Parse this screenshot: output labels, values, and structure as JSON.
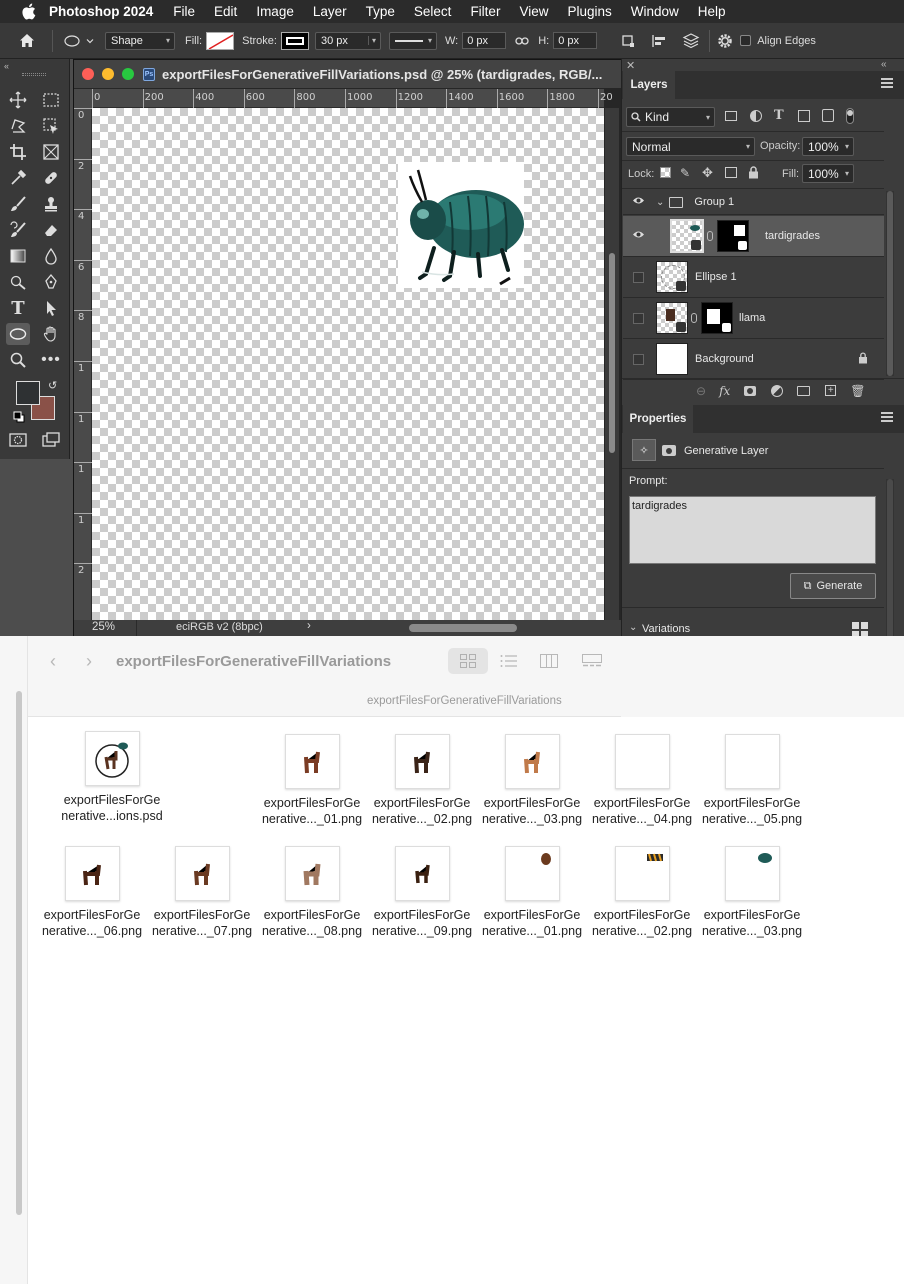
{
  "menubar": {
    "app": "Photoshop 2024",
    "items": [
      "File",
      "Edit",
      "Image",
      "Layer",
      "Type",
      "Select",
      "Filter",
      "View",
      "Plugins",
      "Window",
      "Help"
    ]
  },
  "options": {
    "mode": "Shape",
    "fill_label": "Fill:",
    "stroke_label": "Stroke:",
    "stroke_width": "30 px",
    "w_label": "W:",
    "w_value": "0 px",
    "h_label": "H:",
    "h_value": "0 px",
    "align_edges": "Align Edges"
  },
  "document": {
    "title": "exportFilesForGenerativeFillVariations.psd @ 25% (tardigrades, RGB/...",
    "ruler_h": [
      "0",
      "200",
      "400",
      "600",
      "800",
      "1000",
      "1200",
      "1400",
      "1600",
      "1800",
      "20"
    ],
    "ruler_v": [
      "0",
      "2",
      "4",
      "6",
      "8",
      "1",
      "1",
      "1",
      "1",
      "2"
    ],
    "zoom": "25%",
    "profile": "eciRGB v2 (8bpc)",
    "status_arrow": "›"
  },
  "layers_panel": {
    "tab": "Layers",
    "kind": "Kind",
    "blend": "Normal",
    "opacity_label": "Opacity:",
    "opacity": "100%",
    "lock_label": "Lock:",
    "fill_label": "Fill:",
    "fill": "100%",
    "layers": [
      {
        "name": "Group 1"
      },
      {
        "name": "tardigrades"
      },
      {
        "name": "Ellipse 1"
      },
      {
        "name": "llama"
      },
      {
        "name": "Background"
      }
    ]
  },
  "properties": {
    "tab": "Properties",
    "type": "Generative Layer",
    "prompt_label": "Prompt:",
    "prompt": "tardigrades",
    "generate": "Generate",
    "variations": "Variations"
  },
  "finder": {
    "folder": "exportFilesForGenerativeFillVariations",
    "path": "exportFilesForGenerativeFillVariations",
    "files_row1": [
      {
        "l1": "exportFilesForGe",
        "l2": "nerative...ions.psd"
      },
      {
        "l1": "exportFilesForGe",
        "l2": "nerative..._01.png"
      },
      {
        "l1": "exportFilesForGe",
        "l2": "nerative..._02.png"
      },
      {
        "l1": "exportFilesForGe",
        "l2": "nerative..._03.png"
      },
      {
        "l1": "exportFilesForGe",
        "l2": "nerative..._04.png"
      },
      {
        "l1": "exportFilesForGe",
        "l2": "nerative..._05.png"
      }
    ],
    "files_row2": [
      {
        "l1": "exportFilesForGe",
        "l2": "nerative..._06.png"
      },
      {
        "l1": "exportFilesForGe",
        "l2": "nerative..._07.png"
      },
      {
        "l1": "exportFilesForGe",
        "l2": "nerative..._08.png"
      },
      {
        "l1": "exportFilesForGe",
        "l2": "nerative..._09.png"
      },
      {
        "l1": "exportFilesForGe",
        "l2": "nerative..._01.png"
      },
      {
        "l1": "exportFilesForGe",
        "l2": "nerative..._02.png"
      },
      {
        "l1": "exportFilesForGe",
        "l2": "nerative..._03.png"
      }
    ]
  },
  "colors": {
    "foreground": "#2e3133",
    "background": "#8a5148",
    "beetle": "#1f5b57",
    "selection": "#2f78d8"
  }
}
